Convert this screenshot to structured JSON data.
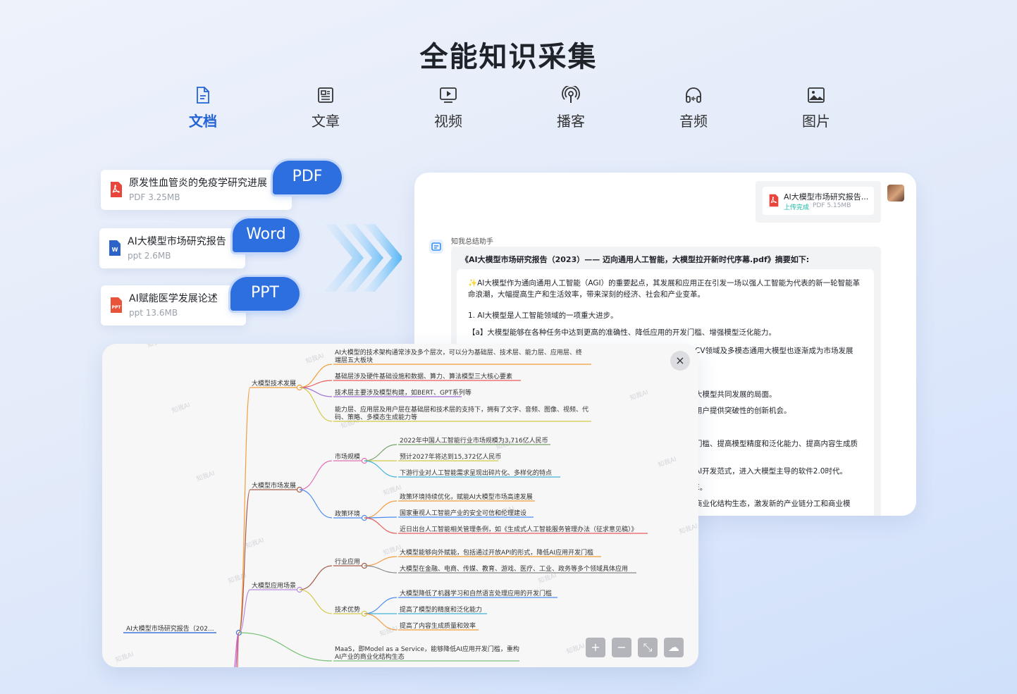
{
  "page_title": "全能知识采集",
  "tabs": [
    {
      "label": "文档",
      "icon": "document-icon",
      "active": true
    },
    {
      "label": "文章",
      "icon": "article-icon",
      "active": false
    },
    {
      "label": "视频",
      "icon": "video-icon",
      "active": false
    },
    {
      "label": "播客",
      "icon": "podcast-icon",
      "active": false
    },
    {
      "label": "音频",
      "icon": "headphones-icon",
      "active": false
    },
    {
      "label": "图片",
      "icon": "image-icon",
      "active": false
    }
  ],
  "files": [
    {
      "name": "原发性血管炎的免疫学研究进展",
      "meta": "PDF 3.25MB",
      "badge": "PDF",
      "icon": "pdf-file-icon"
    },
    {
      "name": "AI大模型市场研究报告",
      "meta": "ppt 2.6MB",
      "badge": "Word",
      "icon": "word-file-icon"
    },
    {
      "name": "AI赋能医学发展论述",
      "meta": "ppt 13.6MB",
      "badge": "PPT",
      "icon": "ppt-file-icon"
    }
  ],
  "chat": {
    "upload": {
      "name": "AI大模型市场研究报告...",
      "status": "上传完成",
      "size": "PDF 5.15MB"
    },
    "assistant_name": "知我总结助手",
    "answer_title": "《AI大模型市场研究报告（2023）—— 迈向通用人工智能，大模型拉开新时代序幕.pdf》摘要如下:",
    "intro": "AI大模型作为通向通用人工智能（AGI）的重要起点，其发展和应用正在引发一场以强人工智能为代表的新一轮智能革命浪潮，大幅提高生产和生活效率，带来深刻的经济、社会和产业变革。",
    "point1": "1. AI大模型是人工智能领域的一项重大进步。",
    "point1a": "【a】大模型能够在各种任务中达到更高的准确性、降低应用的开发门槛、增强模型泛化能力。",
    "partial_lines": [
      "CV领域及多模态通用大模型也逐渐成为市场发展",
      "大模型共同发展的局面。",
      "用户提供突破性的创新机会。",
      "门槛、提高模型精度和泛化能力、提高内容生成质",
      "AI开发范式，进入大模型主导的软件2.0时代。",
      "E。",
      "商业化结构生态，激发新的产业链分工和商业模"
    ]
  },
  "mindmap": {
    "root": "AI大模型市场研究报告（202...",
    "branches": [
      {
        "label": "大模型技术发展",
        "color": "#f39c3d",
        "leaves": [
          {
            "text": "AI大模型的技术架构通常涉及多个层次，可以分为基础层、技术层、能力层、应用层、终",
            "text2": "端层五大板块",
            "color": "#f39c3d"
          },
          {
            "text": "基础层涉及硬件基础设施和数据、算力、算法模型三大核心要素",
            "color": "#e85d5d"
          },
          {
            "text": "技术层主要涉及模型构建，如BERT、GPT系列等",
            "color": "#9b6bd6"
          },
          {
            "text": "能力层、应用层及用户层在基础层和技术层的支持下，拥有了文字、音频、图像、视频、代",
            "text2": "码、策略、多模态生成能力等",
            "color": "#d6c84a"
          }
        ]
      },
      {
        "label": "大模型市场发展",
        "color": "#a65b4a",
        "subs": [
          {
            "label": "市场规模",
            "color": "#e06fb8",
            "leaves": [
              {
                "text": "2022年中国人工智能行业市场规模为3,716亿人民币",
                "color": "#7aa36a"
              },
              {
                "text": "预计2027年将达到15,372亿人民币",
                "color": "#d6c84a"
              },
              {
                "text": "下游行业对人工智能需求呈现出碎片化、多样化的特点",
                "color": "#3fb3d6"
              }
            ]
          },
          {
            "label": "政策环境",
            "color": "#4a8cf2",
            "leaves": [
              {
                "text": "政策环境持续优化，赋能AI大模型市场高速发展",
                "color": "#f39c3d"
              },
              {
                "text": "国家重视人工智能产业的安全可信和伦理建设",
                "color": "#4a8cf2"
              },
              {
                "text": "近日出台人工智能相关管理条例，如《生成式人工智能服务管理办法（征求意见稿）》",
                "color": "#e85d5d"
              }
            ]
          }
        ]
      },
      {
        "label": "大模型应用场景",
        "color": "#b88be0",
        "subs": [
          {
            "label": "行业应用",
            "color": "#a65b4a",
            "leaves": [
              {
                "text": "大模型能够向外赋能，包括通过开放API的形式，降低AI应用开发门槛",
                "color": "#f39c3d"
              },
              {
                "text": "大模型在金融、电商、传媒、教育、游戏、医疗、工业、政务等多个领域具体应用",
                "color": "#888888"
              }
            ]
          },
          {
            "label": "技术优势",
            "color": "#d6c84a",
            "leaves": [
              {
                "text": "大模型降低了机器学习和自然语言处理应用的开发门槛",
                "color": "#4a8cf2"
              },
              {
                "text": "提高了模型的精度和泛化能力",
                "color": "#3fb3d6"
              },
              {
                "text": "提高了内容生成质量和效率",
                "color": "#f39c3d"
              }
            ]
          }
        ]
      }
    ],
    "extra_leaf": {
      "text": "MaaS，即Model as a Service，能够降低AI应用开发门槛，重构",
      "text2": "AI产业的商业化结构生态",
      "color": "#7ac27a"
    },
    "watermark": "知我AI",
    "tools": [
      {
        "name": "zoom-in-button",
        "glyph": "+"
      },
      {
        "name": "zoom-out-button",
        "glyph": "−"
      },
      {
        "name": "fit-screen-button",
        "glyph": "⤡"
      },
      {
        "name": "download-button",
        "glyph": "☁"
      }
    ],
    "close_glyph": "×"
  },
  "colors": {
    "accent": "#2463d6",
    "badge": "#2e6fe0",
    "success": "#14b8a6"
  }
}
